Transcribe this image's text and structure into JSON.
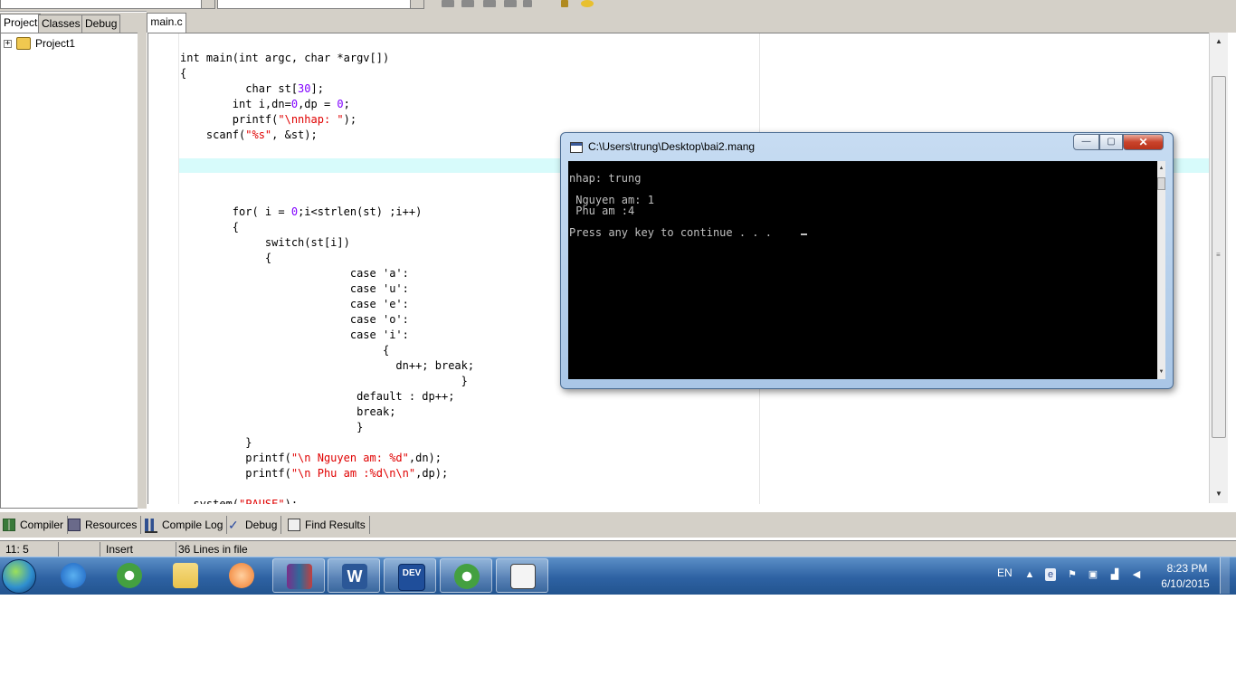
{
  "left_panel": {
    "tabs": [
      "Project",
      "Classes",
      "Debug"
    ],
    "tree_root": "Project1",
    "expander": "+"
  },
  "editor": {
    "tab": "main.c",
    "lines": [
      [
        {
          "t": "int main(int argc, char *argv[])"
        }
      ],
      [
        {
          "t": "{"
        }
      ],
      [
        {
          "t": "          char st["
        },
        {
          "t": "30",
          "c": "num"
        },
        {
          "t": "];"
        }
      ],
      [
        {
          "t": "        int i,dn="
        },
        {
          "t": "0",
          "c": "num"
        },
        {
          "t": ",dp = "
        },
        {
          "t": "0",
          "c": "num"
        },
        {
          "t": ";"
        }
      ],
      [
        {
          "t": "        printf("
        },
        {
          "t": "\"\\nnhap: \"",
          "c": "str"
        },
        {
          "t": ");"
        }
      ],
      [
        {
          "t": "    scanf("
        },
        {
          "t": "\"%s\"",
          "c": "str"
        },
        {
          "t": ", &st);"
        }
      ],
      [
        {
          "t": ""
        }
      ],
      [
        {
          "t": ""
        }
      ],
      [
        {
          "t": ""
        }
      ],
      [
        {
          "t": ""
        }
      ],
      [
        {
          "t": "        for( i = "
        },
        {
          "t": "0",
          "c": "num"
        },
        {
          "t": ";i<strlen(st) ;i++)"
        }
      ],
      [
        {
          "t": "        {"
        }
      ],
      [
        {
          "t": "             switch(st[i])"
        }
      ],
      [
        {
          "t": "             {"
        }
      ],
      [
        {
          "t": "                          case 'a':"
        }
      ],
      [
        {
          "t": "                          case 'u':"
        }
      ],
      [
        {
          "t": "                          case 'e':"
        }
      ],
      [
        {
          "t": "                          case 'o':"
        }
      ],
      [
        {
          "t": "                          case 'i':"
        }
      ],
      [
        {
          "t": "                               {"
        }
      ],
      [
        {
          "t": "                                 dn++; break;"
        }
      ],
      [
        {
          "t": "                                           }"
        }
      ],
      [
        {
          "t": "                           default : dp++;"
        }
      ],
      [
        {
          "t": "                           break;"
        }
      ],
      [
        {
          "t": "                           }"
        }
      ],
      [
        {
          "t": "          }"
        }
      ],
      [
        {
          "t": "          printf("
        },
        {
          "t": "\"\\n Nguyen am: %d\"",
          "c": "str"
        },
        {
          "t": ",dn);"
        }
      ],
      [
        {
          "t": "          printf("
        },
        {
          "t": "\"\\n Phu am :%d\\n\\n\"",
          "c": "str"
        },
        {
          "t": ",dp);"
        }
      ],
      [
        {
          "t": ""
        }
      ],
      [
        {
          "t": "  system("
        },
        {
          "t": "\"PAUSE\"",
          "c": "str"
        },
        {
          "t": ");"
        }
      ]
    ]
  },
  "bottom_tabs": [
    "Compiler",
    "Resources",
    "Compile Log",
    "Debug",
    "Find Results"
  ],
  "statusbar": {
    "position": "11: 5",
    "mode": "Insert",
    "info": "36 Lines in file"
  },
  "console": {
    "title": "C:\\Users\\trung\\Desktop\\bai2.mang",
    "lines": [
      "nhap: trung",
      "",
      " Nguyen am: 1",
      " Phu am :4",
      "",
      "Press any key to continue . . . "
    ],
    "buttons": {
      "min": "—",
      "max": "▢",
      "close": "✕"
    }
  },
  "taskbar": {
    "language": "EN",
    "time": "8:23 PM",
    "date": "6/10/2015",
    "colors": {
      "word": "#2b5797",
      "dev": "#1f4e9a",
      "winrar": "#7a2f8a",
      "chrome": "#44a040",
      "explorer": "#e9c24a",
      "media": "#f07a2a"
    }
  }
}
